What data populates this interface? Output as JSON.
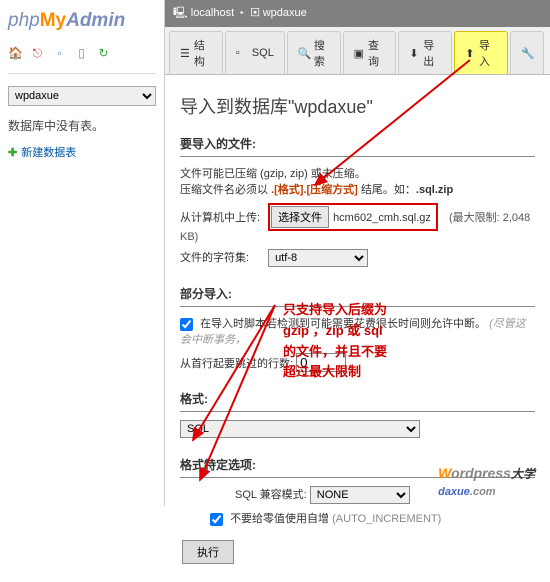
{
  "logo": {
    "php": "php",
    "my": "My",
    "admin": "Admin"
  },
  "sidebar": {
    "db_select": "wpdaxue",
    "empty_text": "数据库中没有表。",
    "new_table": "新建数据表"
  },
  "breadcrumb": {
    "host": "localhost",
    "db": "wpdaxue"
  },
  "tabs": [
    {
      "label": "结构"
    },
    {
      "label": "SQL"
    },
    {
      "label": "搜索"
    },
    {
      "label": "查询"
    },
    {
      "label": "导出"
    },
    {
      "label": "导入"
    },
    {
      "label": ""
    }
  ],
  "heading": "导入到数据库\"wpdaxue\"",
  "import_section": {
    "title": "要导入的文件:",
    "compress_note_a": "文件可能已压缩 (gzip, zip) 或未压缩。",
    "compress_note_b": "压缩文件名必须以 ",
    "compress_fmt": ".[格式].[压缩方式]",
    "compress_note_c": " 结尾。如：",
    "compress_ext": ".sql.zip",
    "upload_label": "从计算机中上传:",
    "choose_btn": "选择文件",
    "file_name": "hcm602_cmh.sql.gz",
    "max_size": "(最大限制: 2,048 KB)",
    "charset_label": "文件的字符集:",
    "charset_value": "utf-8"
  },
  "partial_section": {
    "title": "部分导入:",
    "interrupt": "在导入时脚本若检测到可能需要花费很长时间则允许中断。",
    "interrupt_note": "(尽管这会中断事务，",
    "skip_label": "从首行起要跳过的行数:",
    "skip_value": "0"
  },
  "format_section": {
    "title": "格式:",
    "value": "SQL"
  },
  "format_opts": {
    "title": "格式特定选项:",
    "compat_label": "SQL 兼容模式:",
    "compat_value": "NONE",
    "auto_inc": "不要给零值使用自增",
    "auto_inc_code": "(AUTO_INCREMENT)"
  },
  "exec_btn": "执行",
  "annotation": {
    "l1": "只支持导入后缀为",
    "l2": "gzip ，zip 或 sql",
    "l3": "的文件，并且不要",
    "l4": "超过最大限制"
  },
  "watermark": {
    "w": "W",
    "rest": "ordpress",
    "dx": "daxue",
    "com": ".com"
  }
}
